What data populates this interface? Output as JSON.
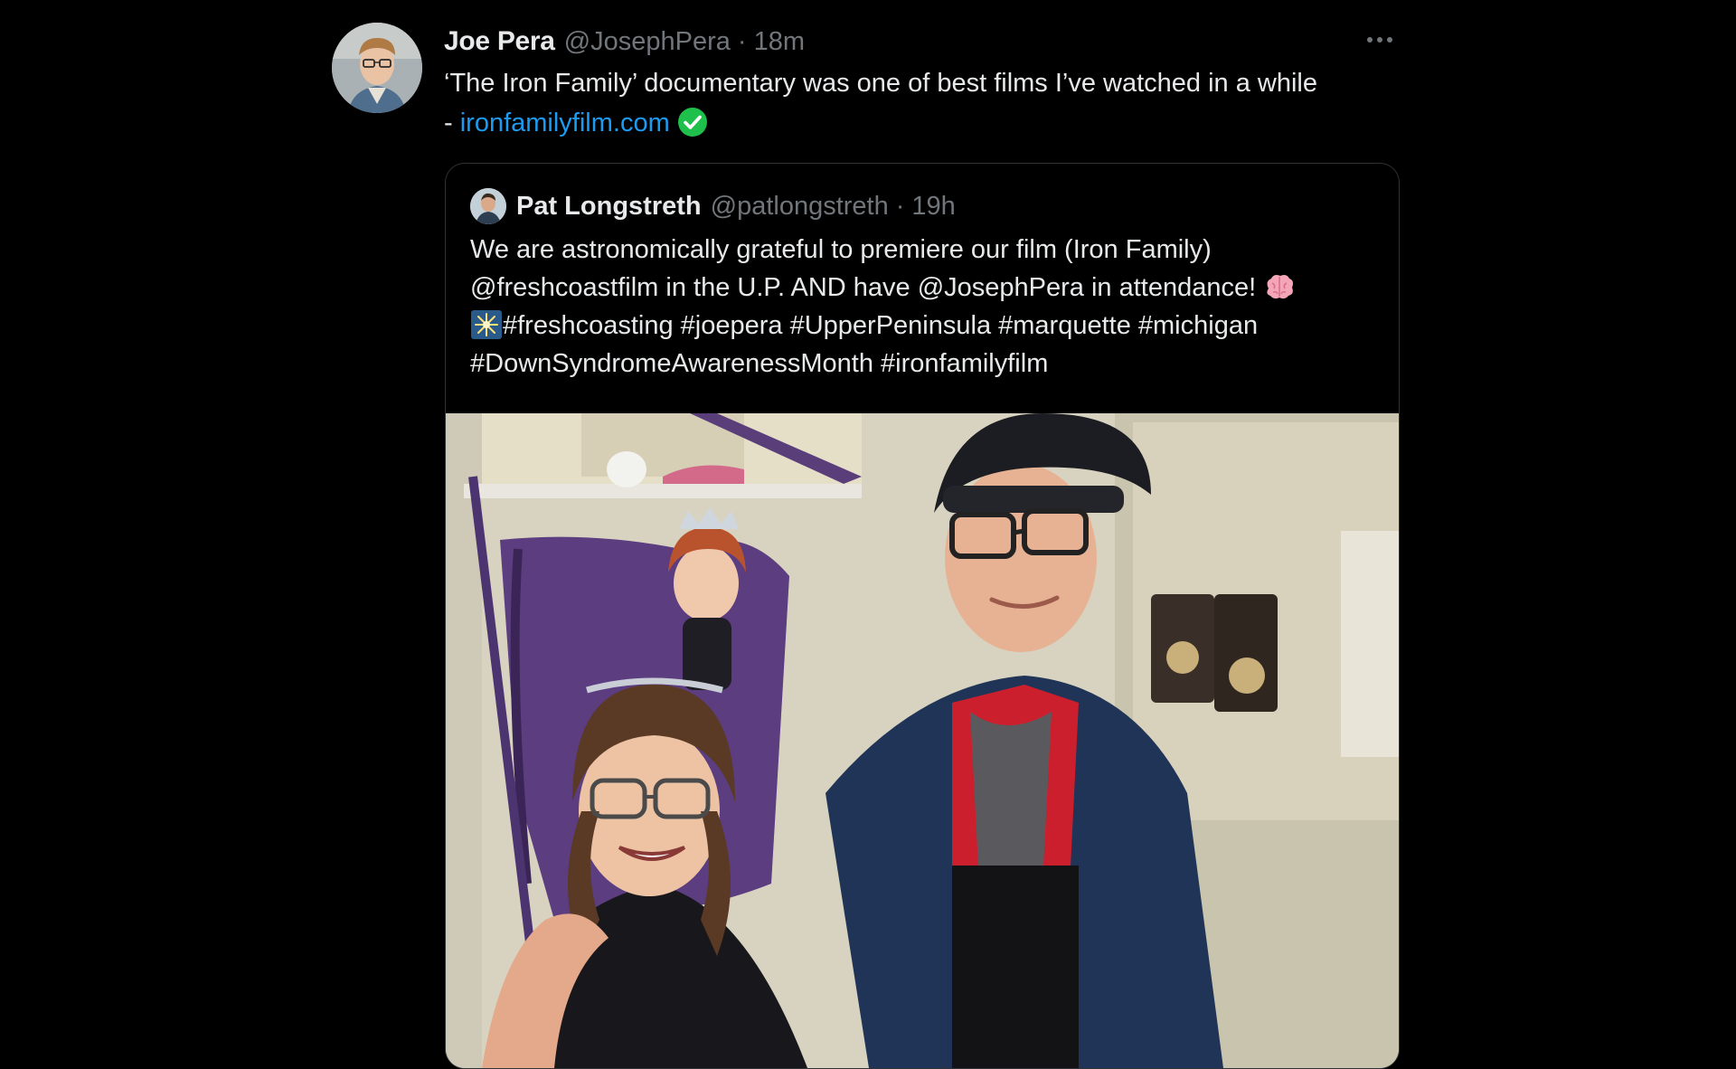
{
  "tweet": {
    "author": {
      "display_name": "Joe Pera",
      "handle": "@JosephPera",
      "avatar_icon": "user-avatar"
    },
    "separator": "·",
    "time": "18m",
    "more_icon": "more-horizontal-icon",
    "text_line1": "‘The Iron Family’ documentary was one of best films I’ve watched in a while",
    "text_prefix": "- ",
    "link_text": "ironfamilyfilm.com",
    "link_emoji": "check-mark-button-emoji"
  },
  "quote": {
    "author": {
      "display_name": "Pat Longstreth",
      "handle": "@patlongstreth",
      "avatar_icon": "user-avatar"
    },
    "separator": "·",
    "time": "19h",
    "lines": {
      "line1": "We are astronomically grateful to premiere our film (Iron Family)",
      "line2": "@freshcoastfilm in the U.P. AND have @JosephPera in attendance! ",
      "line3": "#freshcoasting #joepera #UpperPeninsula #marquette #michigan",
      "line4": "#DownSyndromeAwarenessMonth #ironfamilyfilm"
    },
    "emoji_brain": "brain-emoji",
    "emoji_sparkle": "sparkler-emoji",
    "photo_icon": "photo-two-people-smiling"
  },
  "colors": {
    "background": "#000000",
    "text_primary": "#e7e9ea",
    "text_secondary": "#71767b",
    "link": "#1d9bf0",
    "border": "#2f3336",
    "verified_check": "#1fbf4b"
  }
}
